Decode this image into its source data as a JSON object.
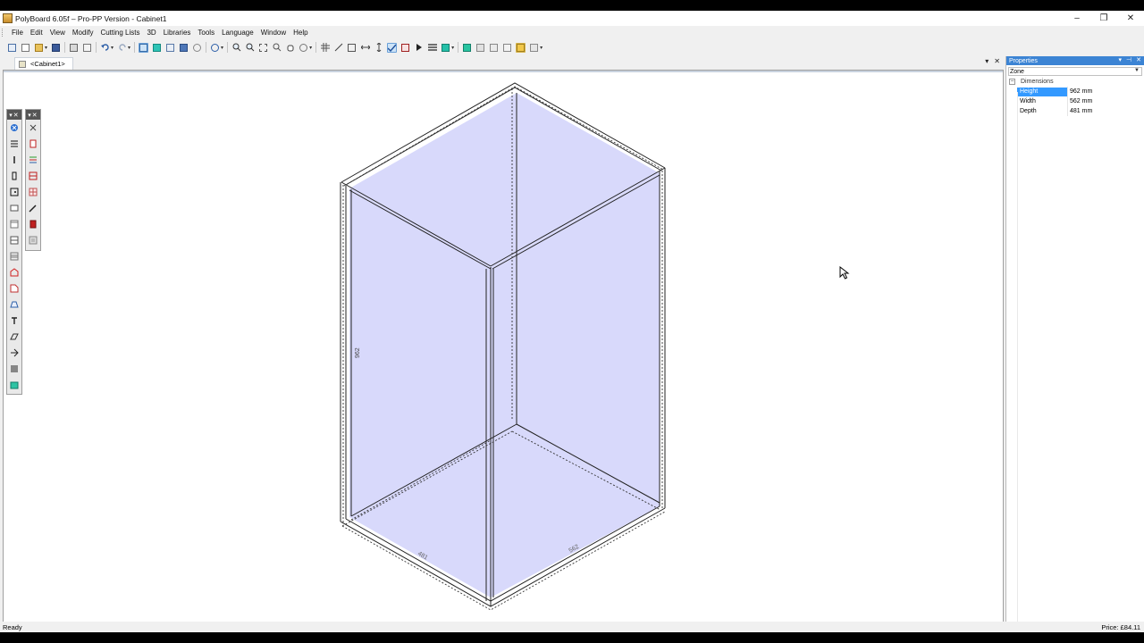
{
  "window": {
    "title": "PolyBoard 6.05f – Pro-PP Version - Cabinet1",
    "minimize": "–",
    "restore": "❐",
    "close": "✕"
  },
  "menu": [
    "File",
    "Edit",
    "View",
    "Modify",
    "Cutting Lists",
    "3D",
    "Libraries",
    "Tools",
    "Language",
    "Window",
    "Help"
  ],
  "document_tab": {
    "label": "<Cabinet1>",
    "dropdown": "▾",
    "close": "✕"
  },
  "drawing": {
    "dimension_height": "962",
    "dimension_depth": "481",
    "dimension_width": "562",
    "fill_color": "#d8d9fb"
  },
  "properties": {
    "title": "Properties",
    "header_controls": [
      "▾",
      "⊣",
      "✕"
    ],
    "zone_select": "Zone",
    "category": "Dimensions",
    "category_toggle": "−",
    "rows": [
      {
        "name": "Height",
        "value": "962 mm"
      },
      {
        "name": "Width",
        "value": "562 mm"
      },
      {
        "name": "Depth",
        "value": "481 mm"
      }
    ]
  },
  "status": {
    "left": "Ready",
    "right": "Price: £84.11"
  }
}
